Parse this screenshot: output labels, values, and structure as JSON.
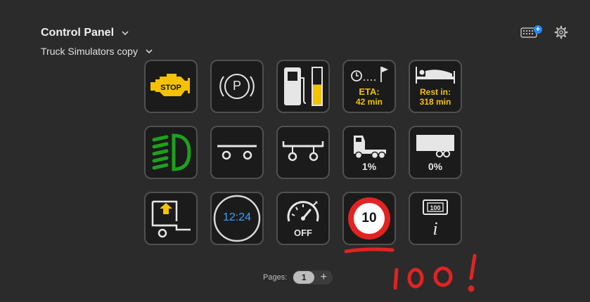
{
  "header": {
    "title": "Control Panel",
    "subtitle": "Truck Simulators copy",
    "kbd_badge": "+"
  },
  "keys": [
    {
      "name": "engine-stop",
      "icon": "engine-check-icon",
      "label": "STOP"
    },
    {
      "name": "parking-brake",
      "icon": "parking-brake-icon",
      "label": "P"
    },
    {
      "name": "fuel",
      "icon": "fuel-gauge-icon",
      "level": 0.55
    },
    {
      "name": "eta",
      "icon": "clock-flag-icon",
      "line1": "ETA:",
      "line2": "42 min"
    },
    {
      "name": "rest",
      "icon": "bed-icon",
      "line1": "Rest in:",
      "line2": "318 min"
    },
    {
      "name": "headlights",
      "icon": "low-beam-icon"
    },
    {
      "name": "trailer-axle",
      "icon": "axle-icon"
    },
    {
      "name": "trailer-raise",
      "icon": "trailer-axle-icon"
    },
    {
      "name": "truck-damage",
      "icon": "truck-icon",
      "label": "1%"
    },
    {
      "name": "trailer-damage",
      "icon": "trailer-icon",
      "label": "0%"
    },
    {
      "name": "lift-axle",
      "icon": "lift-axle-icon"
    },
    {
      "name": "clock",
      "icon": "clock-icon",
      "label": "12:24"
    },
    {
      "name": "cruise-control",
      "icon": "speedometer-icon",
      "label": "OFF"
    },
    {
      "name": "speed-limit",
      "icon": "speed-limit-sign-icon",
      "label": "10"
    },
    {
      "name": "info",
      "icon": "info-sign-icon",
      "sign": "100",
      "label": "i"
    }
  ],
  "pager": {
    "label": "Pages:",
    "current": "1",
    "add": "+"
  },
  "annotation": {
    "text": "100!",
    "color": "#e32222"
  },
  "colors": {
    "accent_yellow": "#f5c200",
    "green": "#1ea01e",
    "blue": "#3aa0ff",
    "red": "#e32222"
  }
}
